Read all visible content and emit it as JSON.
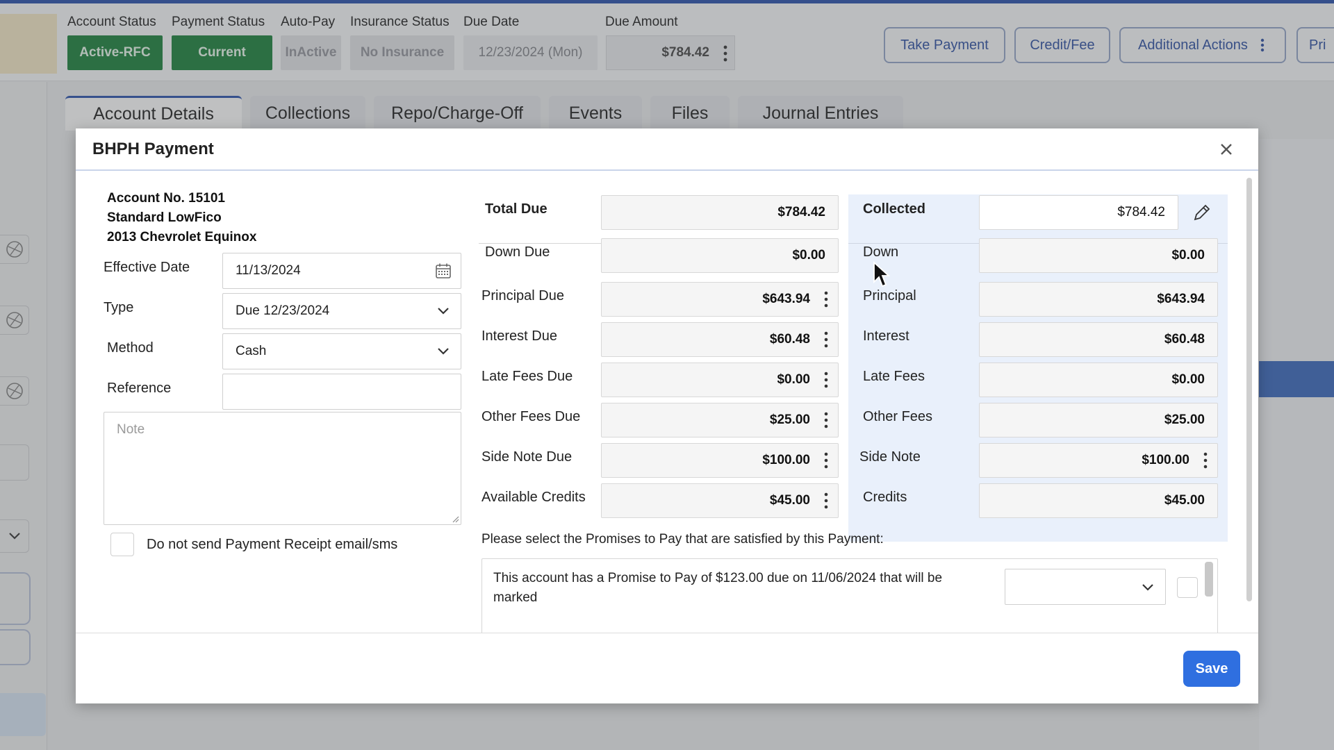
{
  "header": {
    "labels": {
      "account_status": "Account Status",
      "payment_status": "Payment Status",
      "auto_pay": "Auto-Pay",
      "insurance_status": "Insurance Status",
      "due_date": "Due Date",
      "due_amount": "Due Amount"
    },
    "values": {
      "account_status": "Active-RFC",
      "payment_status": "Current",
      "auto_pay": "InActive",
      "insurance_status": "No Insurance",
      "due_date": "12/23/2024 (Mon)",
      "due_amount": "$784.42"
    },
    "buttons": {
      "take_payment": "Take Payment",
      "credit_fee": "Credit/Fee",
      "additional_actions": "Additional Actions",
      "print": "Pri"
    }
  },
  "tabs": [
    {
      "label": "Account Details",
      "active": true
    },
    {
      "label": "Collections"
    },
    {
      "label": "Repo/Charge-Off"
    },
    {
      "label": "Events"
    },
    {
      "label": "Files"
    },
    {
      "label": "Journal Entries"
    }
  ],
  "modal": {
    "title": "BHPH Payment",
    "account": {
      "number": "Account No. 15101",
      "plan": "Standard LowFico",
      "vehicle": "2013 Chevrolet Equinox"
    },
    "form": {
      "effective_date_label": "Effective Date",
      "effective_date_value": "11/13/2024",
      "type_label": "Type",
      "type_value": "Due 12/23/2024",
      "method_label": "Method",
      "method_value": "Cash",
      "reference_label": "Reference",
      "reference_value": "",
      "note_placeholder": "Note",
      "no_receipt_label": "Do not send Payment Receipt email/sms"
    },
    "due": {
      "total_label": "Total Due",
      "total": "$784.42",
      "down_label": "Down Due",
      "down": "$0.00",
      "principal_label": "Principal Due",
      "principal": "$643.94",
      "interest_label": "Interest Due",
      "interest": "$60.48",
      "late_label": "Late Fees Due",
      "late": "$0.00",
      "other_label": "Other Fees Due",
      "other": "$25.00",
      "side_label": "Side Note Due",
      "side": "$100.00",
      "credits_label": "Available Credits",
      "credits": "$45.00"
    },
    "collected": {
      "collected_label": "Collected",
      "collected": "$784.42",
      "down_label": "Down",
      "down": "$0.00",
      "principal_label": "Principal",
      "principal": "$643.94",
      "interest_label": "Interest",
      "interest": "$60.48",
      "late_label": "Late Fees",
      "late": "$0.00",
      "other_label": "Other Fees",
      "other": "$25.00",
      "side_label": "Side Note",
      "side": "$100.00",
      "credits_label": "Credits",
      "credits": "$45.00"
    },
    "promises": {
      "title": "Please select the Promises to Pay that are satisfied by this Payment:",
      "item_text": "This account has a Promise to Pay of $123.00 due on 11/06/2024 that will be marked"
    },
    "save_label": "Save"
  },
  "colors": {
    "accent": "#3b5fb0",
    "status_green": "#2e8a4c",
    "save_blue": "#2f6fe0",
    "collected_panel": "#e9f0fb"
  }
}
